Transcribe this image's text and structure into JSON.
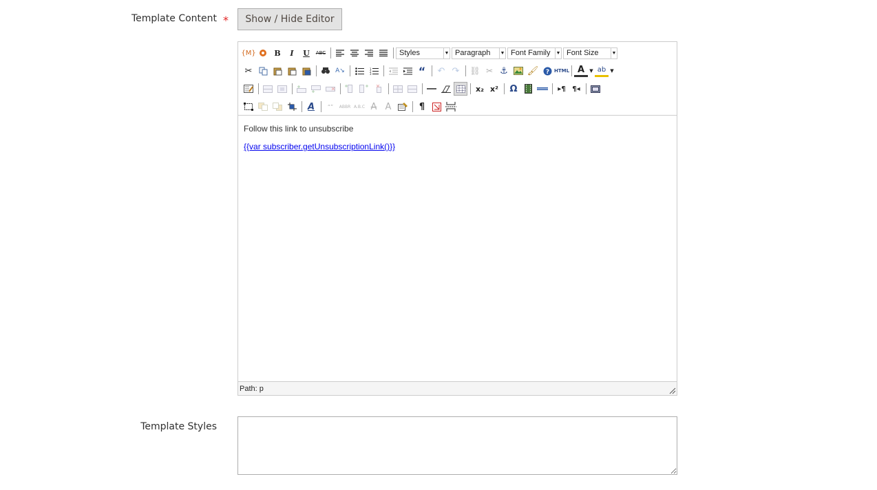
{
  "template_content": {
    "label": "Template Content",
    "required_marker": "*",
    "toggle_button": "Show / Hide Editor"
  },
  "editor": {
    "dropdowns": {
      "styles": "Styles",
      "format": "Paragraph",
      "font_family": "Font Family",
      "font_size": "Font Size"
    },
    "glyphs": {
      "bold": "B",
      "italic": "I",
      "underline": "U",
      "strikethrough": "ABC",
      "blockquote": "“",
      "html": "HTML",
      "text_color": "A",
      "subscript": "x₂",
      "superscript": "x²",
      "char_map": "Ω",
      "pilcrow": "¶",
      "abbr": "ABBR",
      "acronym": "A.B.C",
      "cite": "“”",
      "help": "?"
    },
    "content": {
      "line1": "Follow this link to unsubscribe",
      "link": "{{var subscriber.getUnsubscriptionLink()}}"
    },
    "status_path": "Path: p"
  },
  "template_styles": {
    "label": "Template Styles",
    "value": ""
  },
  "colors": {
    "required": "#e22626",
    "link": "#0000ee",
    "button_bg": "#e3e3e3",
    "border": "#cccccc"
  }
}
